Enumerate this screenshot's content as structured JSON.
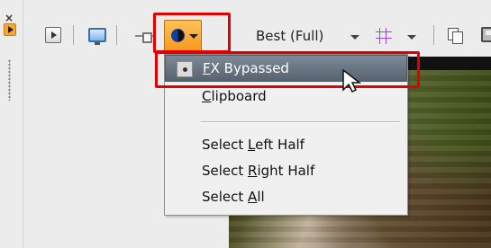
{
  "toolbar": {
    "close_icon": "×",
    "quality_label": "Best (Full)",
    "colors": {
      "accent": "#f4981b",
      "highlight": "#58636f",
      "red_outline": "#e00000",
      "grid_icon": "#a144d8"
    }
  },
  "menu": {
    "items": [
      {
        "label": "FX Bypassed",
        "mnemonic_index": 0,
        "selected": true
      },
      {
        "label": "Clipboard",
        "mnemonic_index": 0,
        "selected": false
      },
      {
        "label": "Select Left Half",
        "mnemonic_index": 7,
        "selected": false
      },
      {
        "label": "Select Right Half",
        "mnemonic_index": 7,
        "selected": false
      },
      {
        "label": "Select All",
        "mnemonic_index": 7,
        "selected": false
      }
    ]
  },
  "icons": [
    "close-icon",
    "play-icon",
    "select-icon",
    "monitor-icon",
    "connector-icon",
    "fx-circle-icon",
    "grid-icon",
    "copy-icon",
    "save-icon",
    "mouse-cursor-icon"
  ]
}
